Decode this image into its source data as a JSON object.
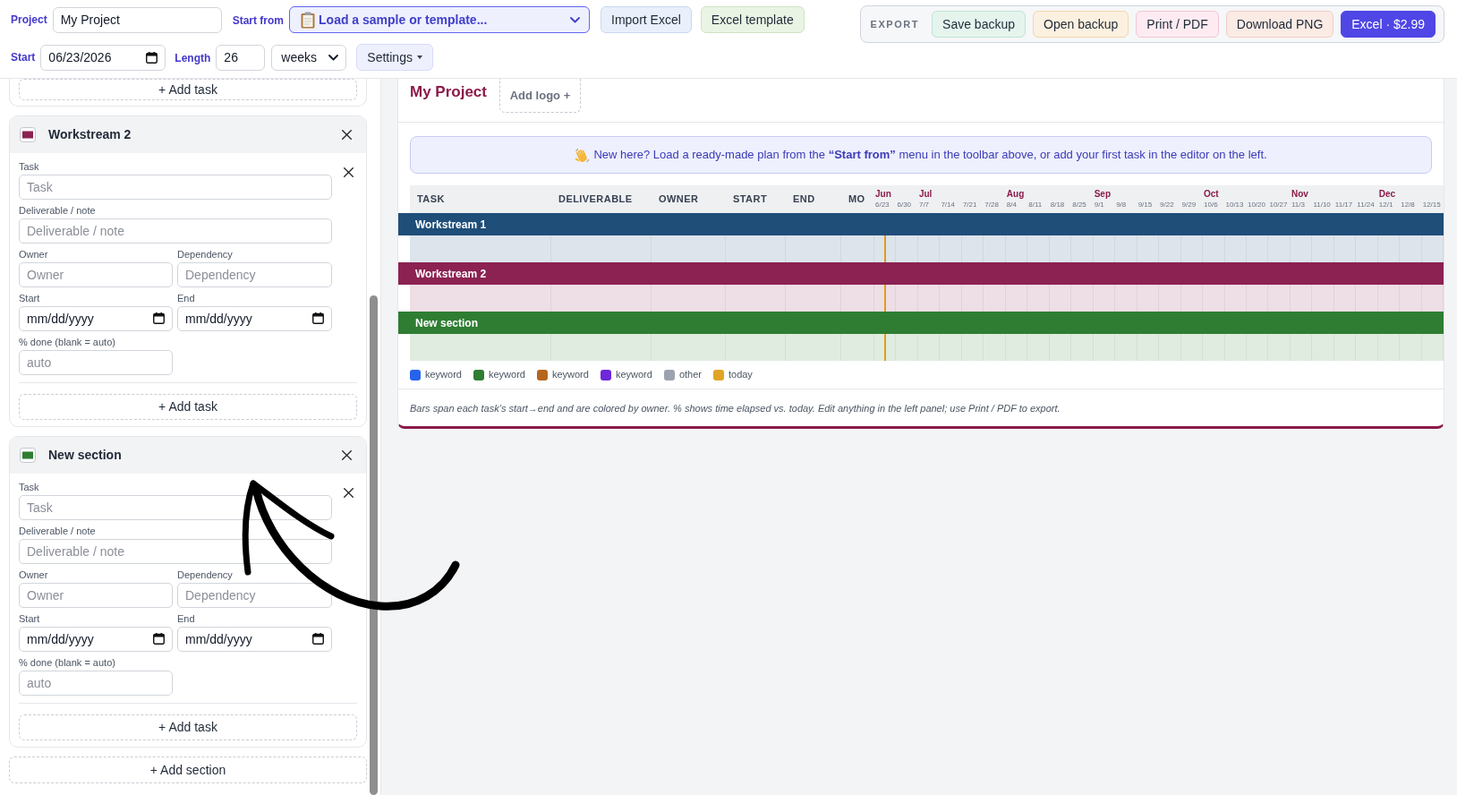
{
  "toolbar": {
    "project": {
      "label": "Project",
      "value": "My Project"
    },
    "start_from": {
      "label": "Start from",
      "value": "Load a sample or template..."
    },
    "buttons": [
      {
        "label": "Import Excel",
        "kind": "sky"
      },
      {
        "label": "Excel template",
        "kind": "lime"
      }
    ],
    "start": {
      "label": "Start",
      "value": "06/23/2026"
    },
    "length": {
      "label": "Length",
      "value": "26",
      "unit": "weeks"
    },
    "settings": "Settings",
    "export": {
      "label": "EXPORT",
      "buttons": [
        {
          "label": "Save backup",
          "kind": "mint"
        },
        {
          "label": "Open backup",
          "kind": "peach"
        },
        {
          "label": "Print / PDF",
          "kind": "rose"
        },
        {
          "label": "Download PNG",
          "kind": "coral"
        },
        {
          "label": "Excel · $2.99",
          "kind": "primary"
        }
      ]
    }
  },
  "editor": {
    "previous_add_task": "+ Add task",
    "sections": [
      {
        "name": "Workstream 2",
        "color": "#8b2252",
        "tasks": [
          {
            "task": {
              "label": "Task",
              "placeholder": "Task"
            },
            "deliverable": {
              "label": "Deliverable / note",
              "placeholder": "Deliverable / note"
            },
            "owner": {
              "label": "Owner",
              "placeholder": "Owner"
            },
            "dependency": {
              "label": "Dependency",
              "placeholder": "Dependency"
            },
            "start": {
              "label": "Start",
              "placeholder": "mm/dd/yyyy"
            },
            "end": {
              "label": "End",
              "placeholder": "mm/dd/yyyy"
            },
            "percent_done": {
              "label": "% done (blank = auto)",
              "placeholder": "auto"
            }
          }
        ],
        "add_task": "+ Add task"
      },
      {
        "name": "New section",
        "color": "#2e7d32",
        "tasks": [
          {
            "task": {
              "label": "Task",
              "placeholder": "Task"
            },
            "deliverable": {
              "label": "Deliverable / note",
              "placeholder": "Deliverable / note"
            },
            "owner": {
              "label": "Owner",
              "placeholder": "Owner"
            },
            "dependency": {
              "label": "Dependency",
              "placeholder": "Dependency"
            },
            "start": {
              "label": "Start",
              "placeholder": "mm/dd/yyyy"
            },
            "end": {
              "label": "End",
              "placeholder": "mm/dd/yyyy"
            },
            "percent_done": {
              "label": "% done (blank = auto)",
              "placeholder": "auto"
            }
          }
        ],
        "add_task": "+ Add task"
      }
    ],
    "add_section": "+ Add section"
  },
  "plan": {
    "title": "My Project",
    "logo_button": "Add logo +",
    "banner": "New here? Load a ready-made plan from the **“Start from”** menu in the toolbar above, or add your first task in the editor on the left.",
    "columns": [
      "TASK",
      "DELIVERABLE",
      "OWNER",
      "START",
      "END",
      "MO"
    ],
    "weeks": [
      {
        "date": "6/23",
        "month": "Jun"
      },
      {
        "date": "6/30"
      },
      {
        "date": "7/7",
        "month": "Jul"
      },
      {
        "date": "7/14"
      },
      {
        "date": "7/21"
      },
      {
        "date": "7/28"
      },
      {
        "date": "8/4",
        "month": "Aug"
      },
      {
        "date": "8/11"
      },
      {
        "date": "8/18"
      },
      {
        "date": "8/25"
      },
      {
        "date": "9/1",
        "month": "Sep"
      },
      {
        "date": "9/8"
      },
      {
        "date": "9/15"
      },
      {
        "date": "9/22"
      },
      {
        "date": "9/29"
      },
      {
        "date": "10/6",
        "month": "Oct"
      },
      {
        "date": "10/13"
      },
      {
        "date": "10/20"
      },
      {
        "date": "10/27"
      },
      {
        "date": "11/3",
        "month": "Nov"
      },
      {
        "date": "11/10"
      },
      {
        "date": "11/17"
      },
      {
        "date": "11/24"
      },
      {
        "date": "12/1",
        "month": "Dec"
      },
      {
        "date": "12/8"
      },
      {
        "date": "12/15"
      }
    ],
    "today_marker": {
      "level": 0.02
    },
    "sections": [
      {
        "name": "Workstream 1",
        "color": "#1f4e79"
      },
      {
        "name": "Workstream 2",
        "color": "#8b2252"
      },
      {
        "name": "New section",
        "color": "#2e7d32"
      }
    ],
    "legend": [
      {
        "label": "keyword",
        "color": "#2563eb"
      },
      {
        "label": "keyword",
        "color": "#2e7d32"
      },
      {
        "label": "keyword",
        "color": "#b5651d"
      },
      {
        "label": "keyword",
        "color": "#6d28d9"
      },
      {
        "label": "other",
        "color": "#9ca3af"
      },
      {
        "label": "today",
        "color": "#e0a526"
      }
    ],
    "footnote": "Bars span each task’s start→end and are colored by owner. % shows time elapsed vs. today. Edit anything in the left panel; use Print / PDF to export."
  }
}
